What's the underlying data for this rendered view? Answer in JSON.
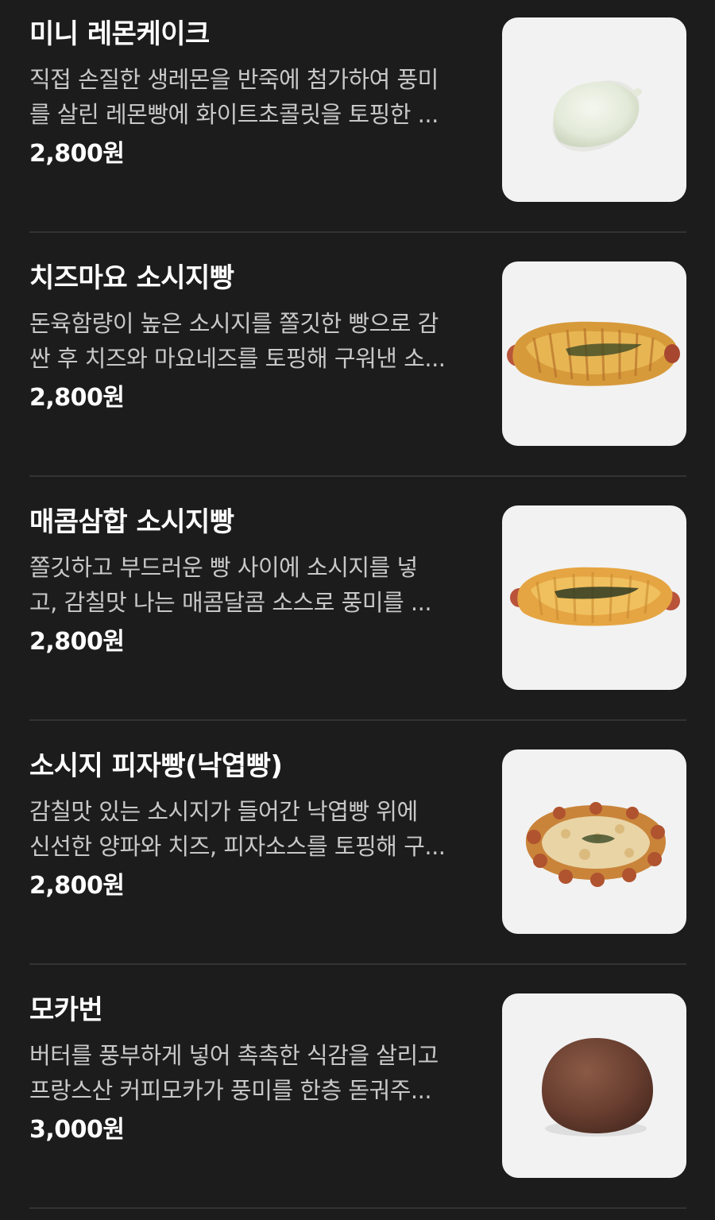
{
  "menu_items": [
    {
      "name": "미니 레몬케이크",
      "description_line1": "직접 손질한 생레몬을 반죽에 첨가하여 풍미",
      "description_line2": "를 살린 레몬빵에 화이트초콜릿을 토핑한 ...",
      "price": "2,800원",
      "image": "lemon-cake-image"
    },
    {
      "name": "치즈마요 소시지빵",
      "description_line1": "돈육함량이 높은 소시지를 쫄깃한 빵으로 감",
      "description_line2": "싼 후 치즈와 마요네즈를 토핑해 구워낸 소...",
      "price": "2,800원",
      "image": "cheese-mayo-sausage-bread-image"
    },
    {
      "name": "매콤삼합 소시지빵",
      "description_line1": "쫄깃하고 부드러운 빵 사이에 소시지를 넣",
      "description_line2": "고, 감칠맛 나는 매콤달콤 소스로 풍미를 ...",
      "price": "2,800원",
      "image": "spicy-sausage-bread-image"
    },
    {
      "name": "소시지 피자빵(낙엽빵)",
      "description_line1": "감칠맛 있는 소시지가 들어간 낙엽빵 위에",
      "description_line2": "신선한 양파와 치즈, 피자소스를 토핑해 구...",
      "price": "2,800원",
      "image": "sausage-pizza-bread-image"
    },
    {
      "name": "모카번",
      "description_line1": "버터를 풍부하게 넣어 촉촉한 식감을 살리고",
      "description_line2": "프랑스산 커피모카가 풍미를 한층 돋궈주...",
      "price": "3,000원",
      "image": "mocha-bun-image"
    }
  ]
}
